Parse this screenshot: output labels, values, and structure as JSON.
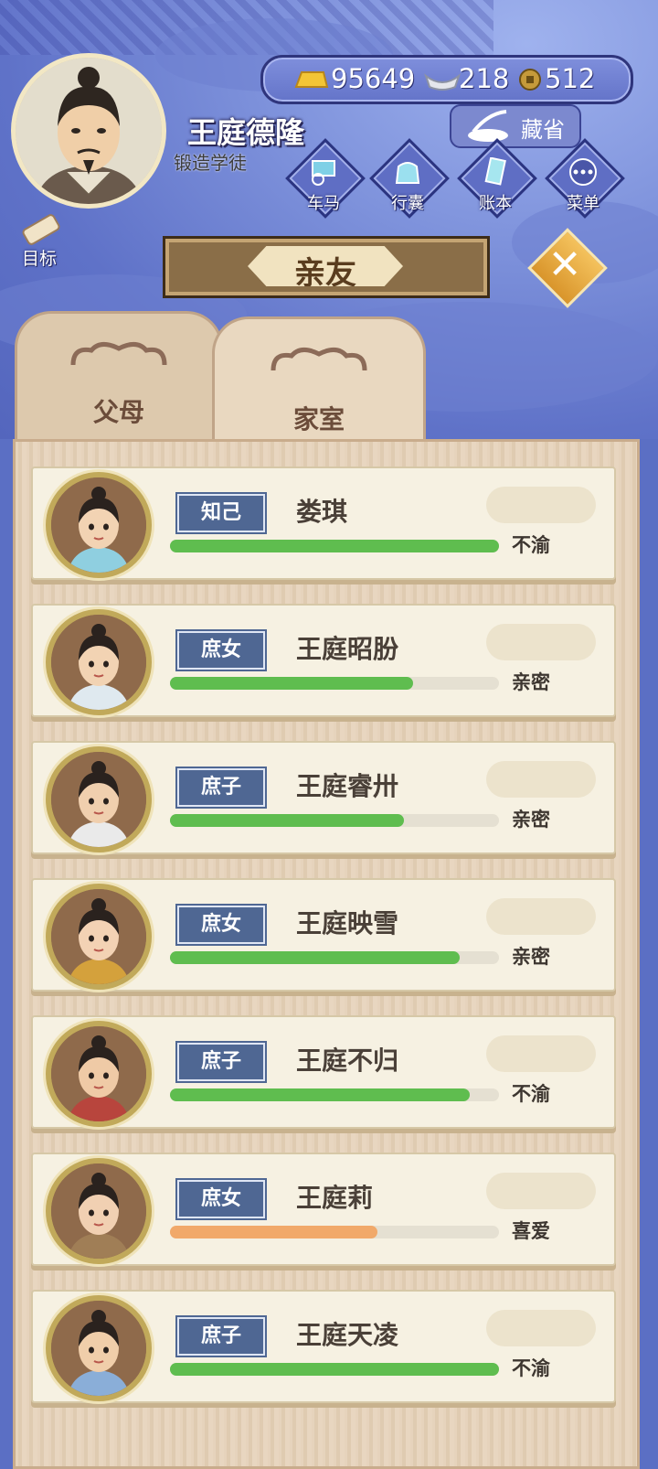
{
  "player": {
    "name": "王庭德隆",
    "rank": "锻造学徒"
  },
  "currency": {
    "gold": "95649",
    "silver": "218",
    "coin": "512"
  },
  "buttons": {
    "cangsheng": "藏省",
    "goal": "目标",
    "title": "亲友",
    "close_icon": "close-icon"
  },
  "menu": [
    {
      "label": "车马",
      "icon": "carriage-icon"
    },
    {
      "label": "行囊",
      "icon": "bag-icon"
    },
    {
      "label": "账本",
      "icon": "ledger-icon"
    },
    {
      "label": "菜单",
      "icon": "more-icon"
    }
  ],
  "tabs": [
    {
      "label": "父母",
      "active": false
    },
    {
      "label": "家室",
      "active": true
    }
  ],
  "colors": {
    "green": "#5fbd4f",
    "orange": "#f1a96a",
    "tag": "#4f6793"
  },
  "members": [
    {
      "relation": "知己",
      "name": "娄琪",
      "status": "不渝",
      "affinity": 1.0,
      "bar_color": "green"
    },
    {
      "relation": "庶女",
      "name": "王庭昭朌",
      "status": "亲密",
      "affinity": 0.74,
      "bar_color": "green"
    },
    {
      "relation": "庶子",
      "name": "王庭睿卅",
      "status": "亲密",
      "affinity": 0.71,
      "bar_color": "green"
    },
    {
      "relation": "庶女",
      "name": "王庭映雪",
      "status": "亲密",
      "affinity": 0.88,
      "bar_color": "green"
    },
    {
      "relation": "庶子",
      "name": "王庭不归",
      "status": "不渝",
      "affinity": 0.91,
      "bar_color": "green"
    },
    {
      "relation": "庶女",
      "name": "王庭莉",
      "status": "喜爱",
      "affinity": 0.63,
      "bar_color": "orange"
    },
    {
      "relation": "庶子",
      "name": "王庭天凌",
      "status": "不渝",
      "affinity": 1.0,
      "bar_color": "green"
    }
  ]
}
